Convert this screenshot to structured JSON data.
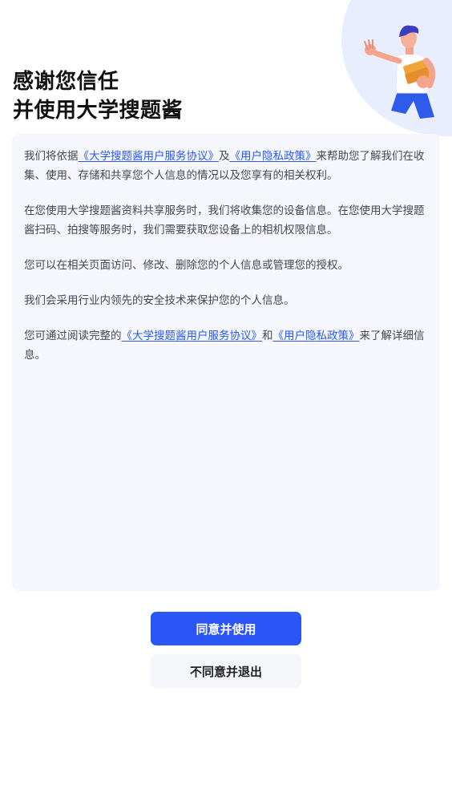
{
  "header": {
    "title_line1": "感谢您信任",
    "title_line2": "并使用大学搜题酱"
  },
  "agreement": {
    "p1_a": "我们将依据",
    "p1_link1": "《大学搜题酱用户服务协议》",
    "p1_b": "及",
    "p1_link2": "《用户隐私政策》",
    "p1_c": "来帮助您了解我们在收集、使用、存储和共享您个人信息的情况以及您享有的相关权利。",
    "p2": "在您使用大学搜题酱资料共享服务时，我们将收集您的设备信息。在您使用大学搜题酱扫码、拍搜等服务时，我们需要获取您设备上的相机权限信息。",
    "p3": "您可以在相关页面访问、修改、删除您的个人信息或管理您的授权。",
    "p4": "我们会采用行业内领先的安全技术来保护您的个人信息。",
    "p5_a": "您可通过阅读完整的",
    "p5_link1": "《大学搜题酱用户服务协议》",
    "p5_b": "和",
    "p5_link2": "《用户隐私政策》",
    "p5_c": "来了解详细信息。"
  },
  "buttons": {
    "agree": "同意并使用",
    "decline": "不同意并退出"
  },
  "colors": {
    "primary": "#2b55f7",
    "link": "#2a58f5",
    "card_bg": "#f5f7fc"
  },
  "icons": {
    "illustration": "person-holding-books-icon"
  }
}
